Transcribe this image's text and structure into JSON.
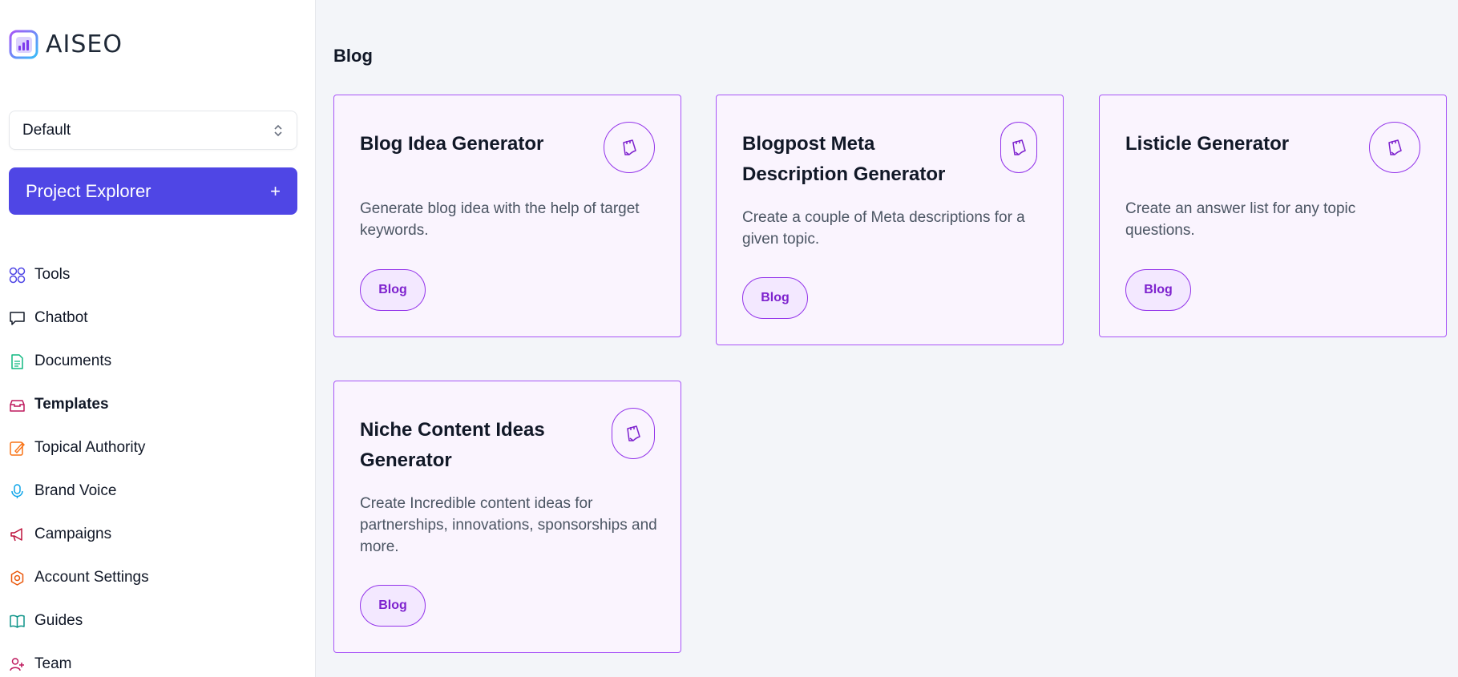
{
  "brand": {
    "name": "AISEO"
  },
  "project_select": {
    "value": "Default"
  },
  "explorer_button": {
    "label": "Project Explorer",
    "plus": "+"
  },
  "nav": [
    {
      "label": "Tools",
      "icon": "grid-icon",
      "active": false
    },
    {
      "label": "Chatbot",
      "icon": "chat-bubble-icon",
      "active": false
    },
    {
      "label": "Documents",
      "icon": "document-icon",
      "active": false
    },
    {
      "label": "Templates",
      "icon": "archive-box-icon",
      "active": true
    },
    {
      "label": "Topical Authority",
      "icon": "feather-pen-icon",
      "active": false
    },
    {
      "label": "Brand Voice",
      "icon": "microphone-icon",
      "active": false
    },
    {
      "label": "Campaigns",
      "icon": "megaphone-icon",
      "active": false
    },
    {
      "label": "Account Settings",
      "icon": "gear-icon",
      "active": false
    },
    {
      "label": "Guides",
      "icon": "open-book-icon",
      "active": false
    },
    {
      "label": "Team",
      "icon": "user-plus-icon",
      "active": false
    }
  ],
  "section": {
    "title": "Blog"
  },
  "cards": [
    {
      "title": "Blog Idea Generator",
      "description": "Generate blog idea with the help of target keywords.",
      "tag": "Blog",
      "icon": "sticky-note-icon"
    },
    {
      "title": "Blogpost Meta Description Generator",
      "description": "Create a couple of Meta descriptions for a given topic.",
      "tag": "Blog",
      "icon": "sticky-note-icon"
    },
    {
      "title": "Listicle Generator",
      "description": "Create an answer list for any topic questions.",
      "tag": "Blog",
      "icon": "sticky-note-icon"
    },
    {
      "title": "Niche Content Ideas Generator",
      "description": "Create Incredible content ideas for partnerships, innovations, sponsorships and more.",
      "tag": "Blog",
      "icon": "sticky-note-icon"
    }
  ],
  "colors": {
    "accent": "#4f46e5",
    "card_border": "#a855f7",
    "card_bg": "#faf4fe",
    "tag_text": "#7e22ce"
  }
}
